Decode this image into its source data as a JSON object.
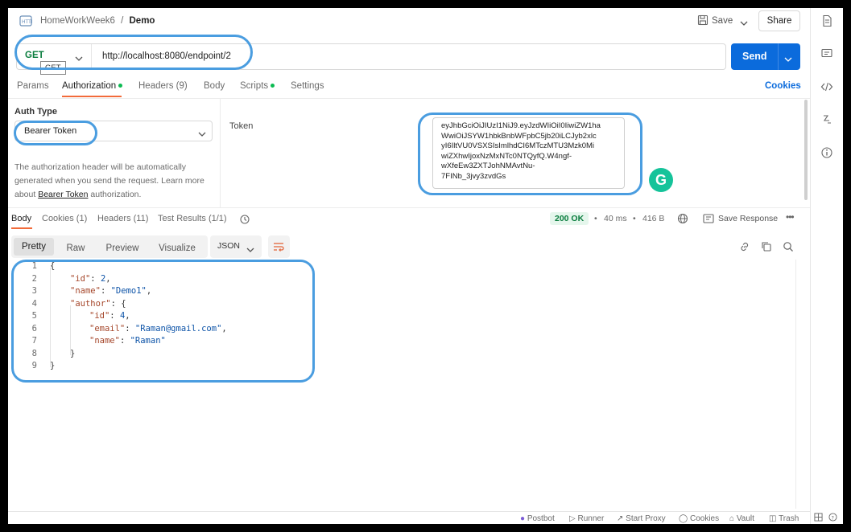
{
  "breadcrumb": {
    "collection": "HomeWorkWeek6",
    "separator": "/",
    "request": "Demo"
  },
  "header": {
    "save_label": "Save",
    "share_label": "Share"
  },
  "request": {
    "method": "GET",
    "method_tooltip": "GET",
    "url": "http://localhost:8080/endpoint/2",
    "send_label": "Send"
  },
  "tabs": [
    {
      "label": "Params"
    },
    {
      "label": "Authorization"
    },
    {
      "label": "Headers (9)"
    },
    {
      "label": "Body"
    },
    {
      "label": "Scripts"
    },
    {
      "label": "Settings"
    }
  ],
  "cookies_link": "Cookies",
  "auth": {
    "type_label": "Auth Type",
    "type_value": "Bearer Token",
    "desc_line1": "The authorization header will be automatically",
    "desc_line2": "generated when you send the request. Learn more",
    "desc_prefix": "about",
    "desc_link": "Bearer Token",
    "desc_suffix": "authorization.",
    "token_label": "Token",
    "token_lines": [
      "eyJhbGciOiJIUzI1NiJ9.eyJzdWIiOiI0IiwiZW1ha",
      "WwiOiJSYW1hbkBnbWFpbC5jb20iLCJyb2xlc",
      "yI6IltVU0VSXSIsImlhdCI6MTczMTU3Mzk0Mi",
      "wiZXhwIjoxNzMxNTc0NTQyfQ.W4ngf-",
      "wXfeEw3ZXTJohNMAvtNu-",
      "7FINb_3jvy3zvdGs"
    ],
    "grammarly_letter": "G"
  },
  "response": {
    "tabs": [
      {
        "label": "Body"
      },
      {
        "label": "Cookies (1)"
      },
      {
        "label": "Headers (11)"
      },
      {
        "label": "Test Results (1/1)"
      }
    ],
    "status": "200 OK",
    "time": "40 ms",
    "size": "416 B",
    "save_response": "Save Response",
    "views": [
      "Pretty",
      "Raw",
      "Preview",
      "Visualize"
    ],
    "format": "JSON",
    "lines": [
      "1",
      "2",
      "3",
      "4",
      "5",
      "6",
      "7",
      "8",
      "9"
    ],
    "json": {
      "open": "{",
      "id_key": "\"id\"",
      "id_val": "2",
      "name_key": "\"name\"",
      "name_val": "\"Demo1\"",
      "author_key": "\"author\"",
      "author_open": "{",
      "a_id_key": "\"id\"",
      "a_id_val": "4",
      "a_email_key": "\"email\"",
      "a_email_val": "\"Raman@gmail.com\"",
      "a_name_key": "\"name\"",
      "a_name_val": "\"Raman\"",
      "inner_close": "}",
      "close": "}"
    }
  },
  "footer": {
    "postbot": "Postbot",
    "runner": "Runner",
    "start_proxy": "Start Proxy",
    "cookies": "Cookies",
    "vault": "Vault",
    "trash": "Trash"
  },
  "colors": {
    "accent": "#0b6bdc",
    "method_green": "#0a7d3e",
    "status_bg": "#e5f6ec",
    "annotation": "#4a9de0"
  }
}
